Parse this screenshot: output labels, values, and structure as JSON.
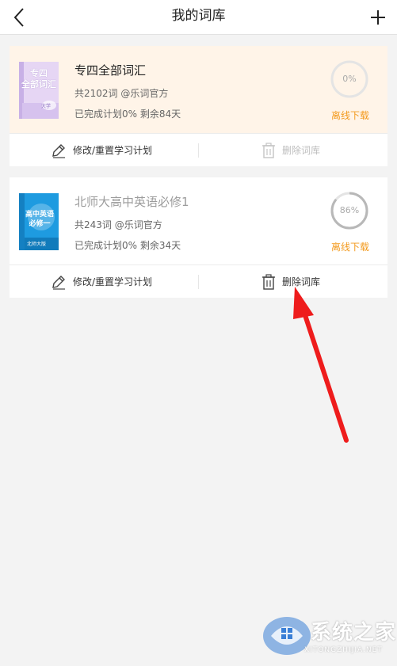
{
  "header": {
    "title": "我的词库",
    "back_icon": "chevron-left-icon",
    "add_icon": "plus-icon"
  },
  "books": [
    {
      "title": "专四全部词汇",
      "cover_text": "专四\n全部词汇",
      "cover_badge": "大学",
      "meta": "共2102词  @乐词官方",
      "progress_text": "已完成计划0% 剩余84天",
      "percent_label": "0%",
      "percent": 0,
      "download_label": "离线下载",
      "edit_label": "修改/重置学习计划",
      "delete_label": "删除词库",
      "delete_enabled": false
    },
    {
      "title": "北师大高中英语必修1",
      "cover_text": "高中英语\n必修一",
      "cover_badge": "北师大版",
      "meta": "共243词  @乐词官方",
      "progress_text": "已完成计划0% 剩余34天",
      "percent_label": "86%",
      "percent": 86,
      "download_label": "离线下载",
      "edit_label": "修改/重置学习计划",
      "delete_label": "删除词库",
      "delete_enabled": true
    }
  ],
  "watermark": {
    "text": "系统之家",
    "sub": "XITONGZHIJIA.NET"
  },
  "colors": {
    "accent": "#f39a1e",
    "highlight_card": "#fff4e8",
    "arrow": "#ee1c1c"
  }
}
